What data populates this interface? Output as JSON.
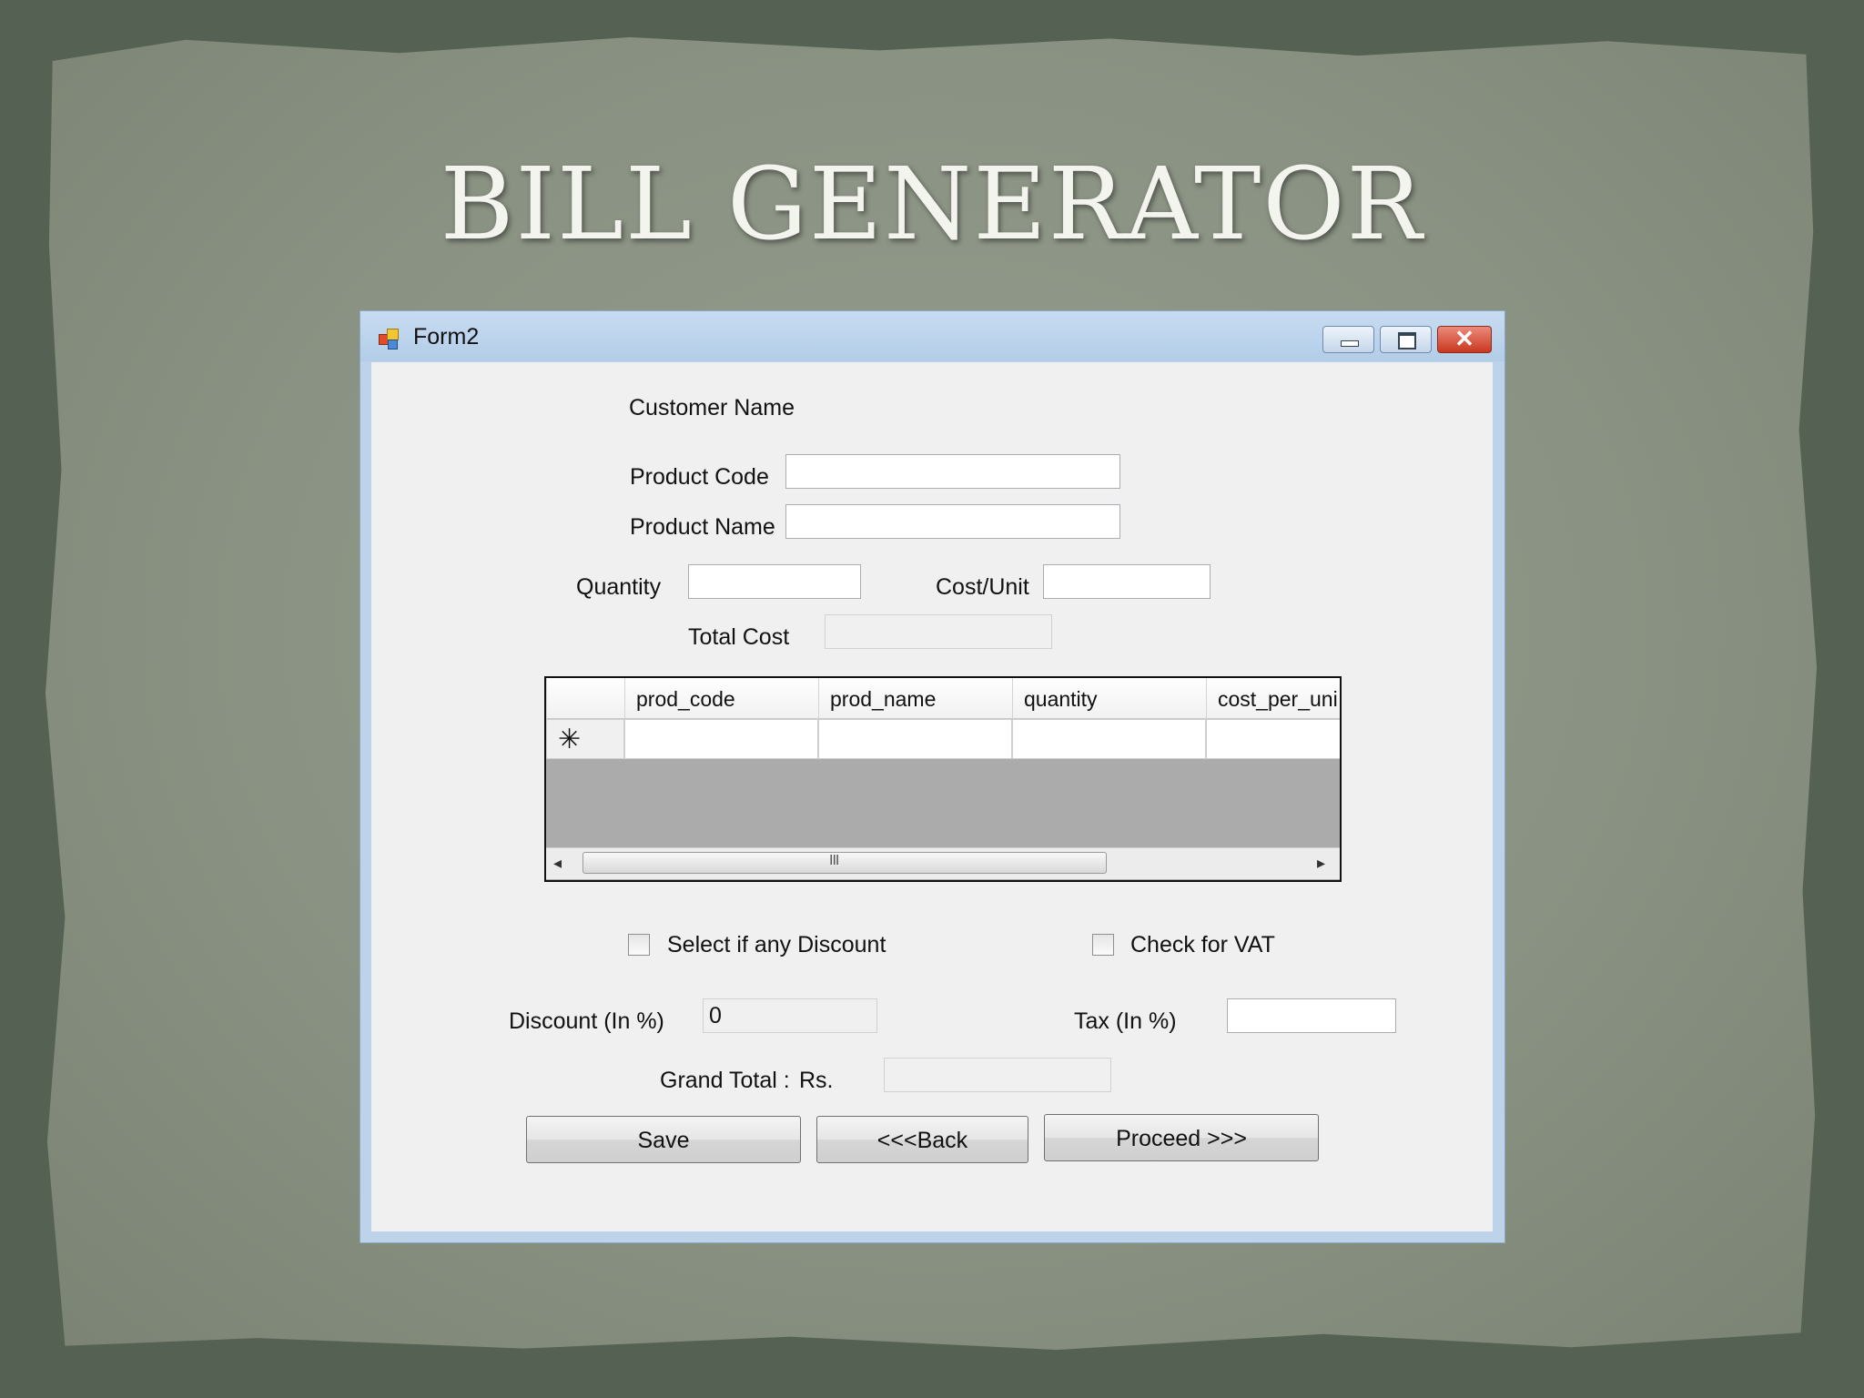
{
  "slide": {
    "title": "BILL GENERATOR"
  },
  "window": {
    "title": "Form2",
    "close_glyph": "✕"
  },
  "form": {
    "customer_name_label": "Customer Name",
    "product_code_label": "Product Code",
    "product_code_value": "",
    "product_name_label": "Product Name",
    "product_name_value": "",
    "quantity_label": "Quantity",
    "quantity_value": "",
    "cost_unit_label": "Cost/Unit",
    "cost_unit_value": "",
    "total_cost_label": "Total Cost",
    "total_cost_value": ""
  },
  "grid": {
    "columns": [
      "prod_code",
      "prod_name",
      "quantity",
      "cost_per_uni"
    ],
    "new_row_marker": "✳",
    "scroll_left": "◂",
    "scroll_right": "▸",
    "scroll_grip": "III"
  },
  "options": {
    "discount_checkbox_label": "Select if any Discount",
    "discount_checked": false,
    "vat_checkbox_label": "Check for VAT",
    "vat_checked": false
  },
  "totals": {
    "discount_label": "Discount (In %)",
    "discount_value": "0",
    "tax_label": "Tax (In %)",
    "tax_value": "",
    "grand_total_label": "Grand Total :",
    "currency_label": "Rs.",
    "grand_total_value": ""
  },
  "buttons": {
    "save": "Save",
    "back": "<<<Back",
    "proceed": "Proceed >>>"
  },
  "colors": {
    "slide_background": "#556152",
    "titlebar": "#bcd3ea",
    "client": "#f0f0f0",
    "close_button": "#c9381f"
  }
}
